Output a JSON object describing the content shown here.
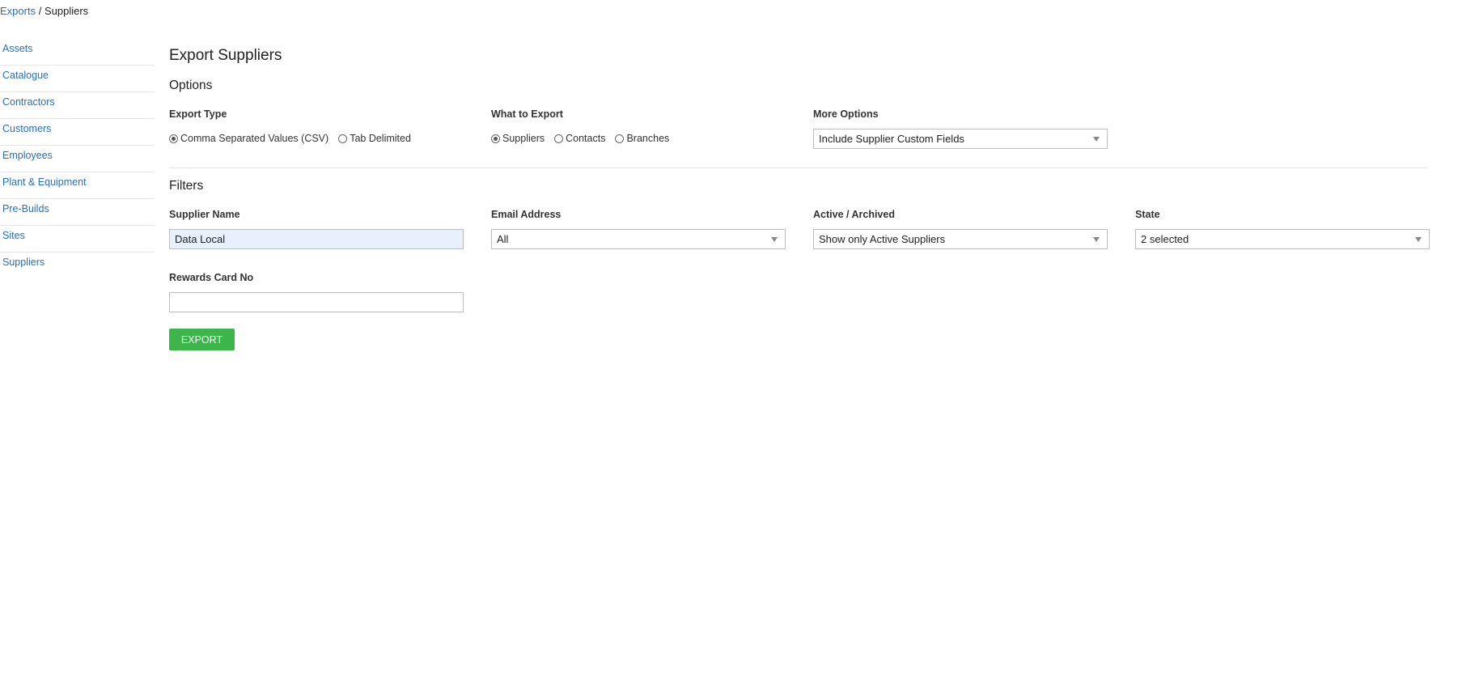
{
  "breadcrumb": {
    "parent": "Exports",
    "separator": "/",
    "current": "Suppliers"
  },
  "sidebar": {
    "items": [
      {
        "label": "Assets"
      },
      {
        "label": "Catalogue"
      },
      {
        "label": "Contractors"
      },
      {
        "label": "Customers"
      },
      {
        "label": "Employees"
      },
      {
        "label": "Plant & Equipment"
      },
      {
        "label": "Pre-Builds"
      },
      {
        "label": "Sites"
      },
      {
        "label": "Suppliers"
      }
    ]
  },
  "page_title": "Export Suppliers",
  "options": {
    "title": "Options",
    "export_type": {
      "label": "Export Type",
      "choices": [
        "Comma Separated Values (CSV)",
        "Tab Delimited"
      ],
      "selected": "Comma Separated Values (CSV)"
    },
    "what_to_export": {
      "label": "What to Export",
      "choices": [
        "Suppliers",
        "Contacts",
        "Branches"
      ],
      "selected": "Suppliers"
    },
    "more_options": {
      "label": "More Options",
      "value": "Include Supplier Custom Fields"
    }
  },
  "filters": {
    "title": "Filters",
    "supplier_name": {
      "label": "Supplier Name",
      "value": "Data Local"
    },
    "email_address": {
      "label": "Email Address",
      "value": "All"
    },
    "active_archived": {
      "label": "Active / Archived",
      "value": "Show only Active Suppliers"
    },
    "state": {
      "label": "State",
      "value": "2 selected"
    },
    "rewards_card": {
      "label": "Rewards Card No",
      "value": ""
    }
  },
  "export_button": "EXPORT",
  "colors": {
    "link": "#2a6fbd",
    "export_button": "#3cb54a",
    "autofill_bg": "#e8f0fe"
  }
}
